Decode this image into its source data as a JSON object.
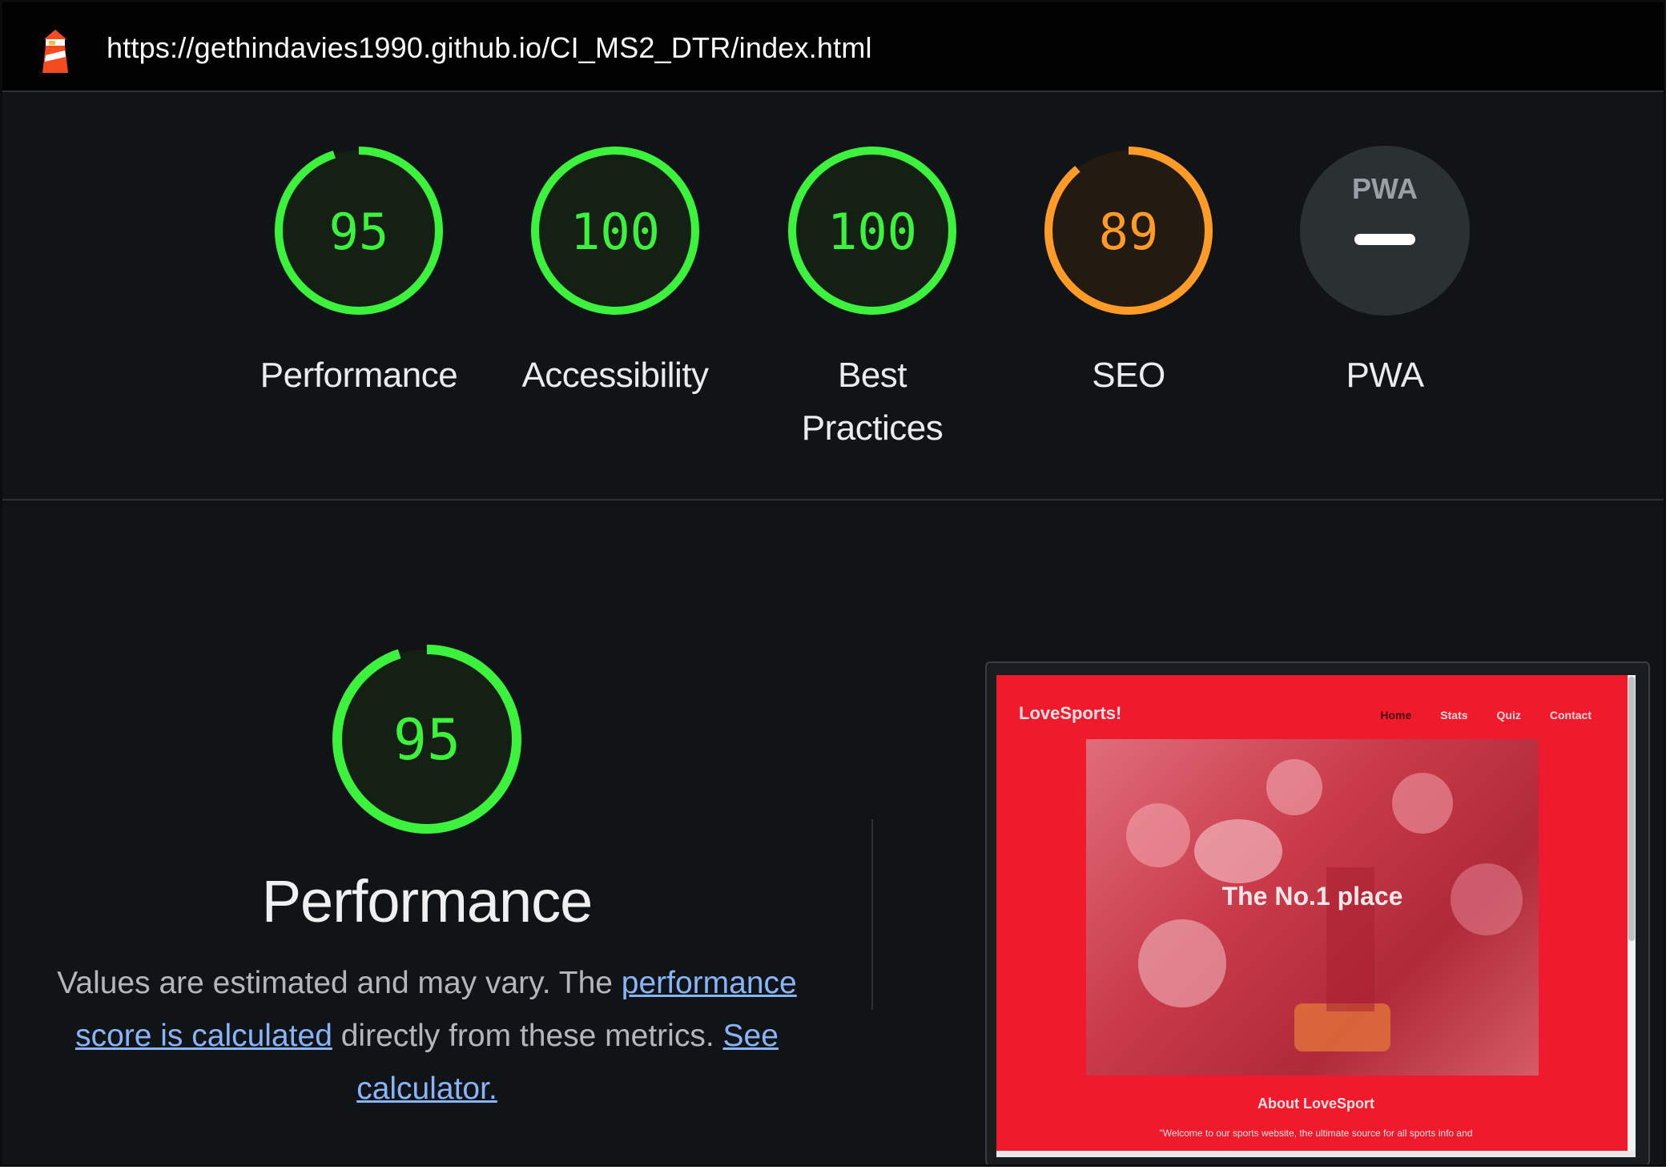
{
  "header": {
    "url": "https://gethindavies1990.github.io/CI_MS2_DTR/index.html",
    "logo_icon": "lighthouse-icon"
  },
  "colors": {
    "pass": "#3df23d",
    "average": "#ff9b26",
    "pwa_bg": "#2b3033",
    "link": "#8ab4f8"
  },
  "gauges": [
    {
      "id": "performance",
      "score": "95",
      "value": 95,
      "status": "pass",
      "label": "Performance"
    },
    {
      "id": "accessibility",
      "score": "100",
      "value": 100,
      "status": "pass",
      "label": "Accessibility"
    },
    {
      "id": "best-practices",
      "score": "100",
      "value": 100,
      "status": "pass",
      "label_line1": "Best",
      "label_line2": "Practices"
    },
    {
      "id": "seo",
      "score": "89",
      "value": 89,
      "status": "average",
      "label": "SEO"
    },
    {
      "id": "pwa",
      "badge": "PWA",
      "label": "PWA"
    }
  ],
  "performance_section": {
    "score": "95",
    "value": 95,
    "title": "Performance",
    "desc_part1": "Values are estimated and may vary. The ",
    "link1": "performance score is calculated",
    "desc_part2": " directly from these metrics. ",
    "link2": "See calculator."
  },
  "thumbnail": {
    "brand": "LoveSports!",
    "nav": [
      "Home",
      "Stats",
      "Quiz",
      "Contact"
    ],
    "hero_text": "The No.1 place",
    "about_heading": "About LoveSport",
    "body_text": "\"Welcome to our sports website, the ultimate source for all sports info and"
  }
}
